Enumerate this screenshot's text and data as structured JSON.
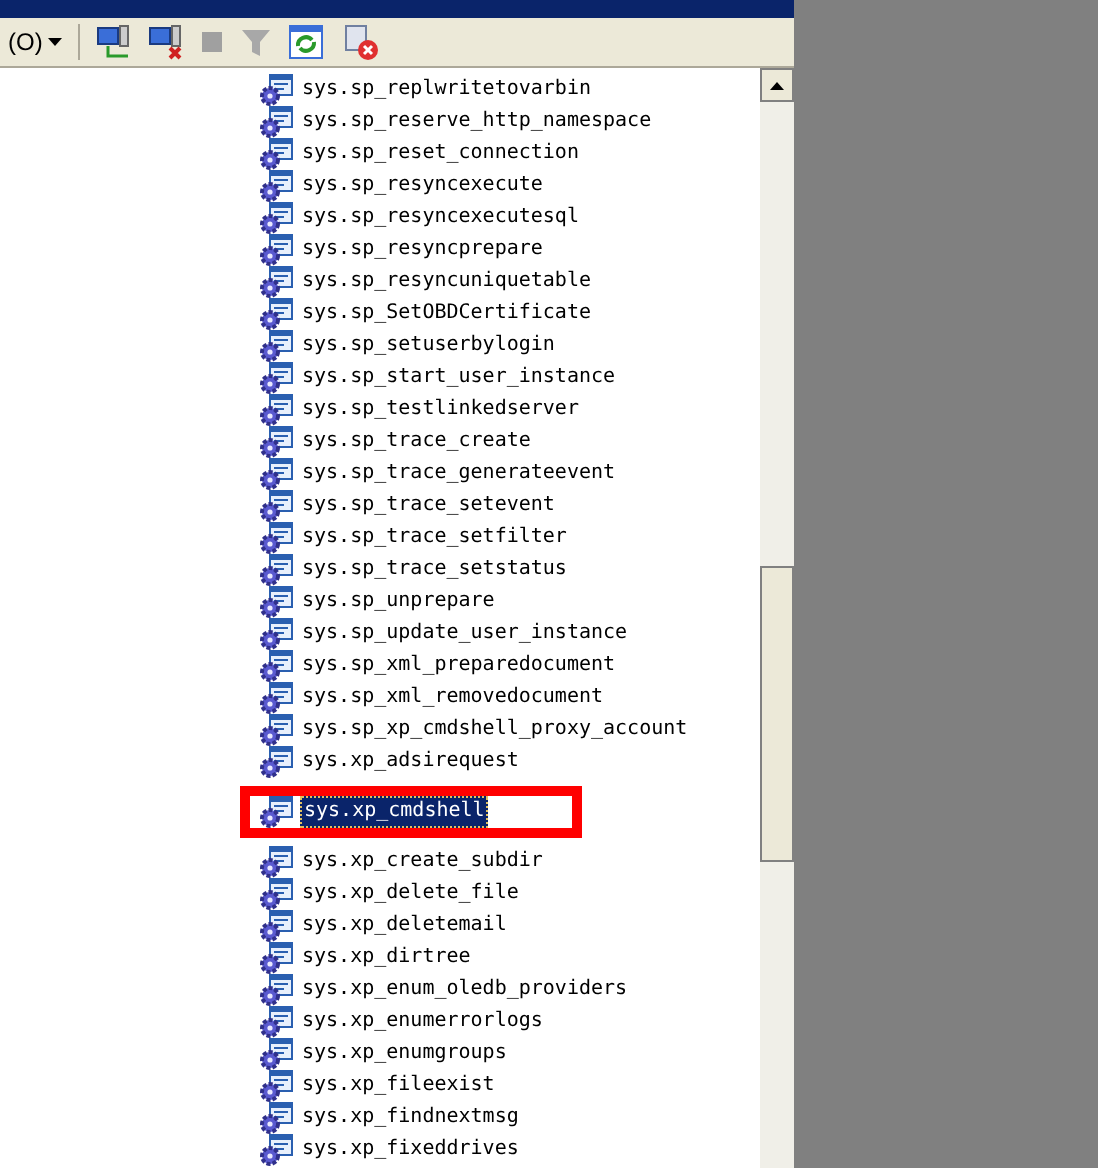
{
  "toolbar": {
    "connect_label": "(O)"
  },
  "tree": {
    "items": [
      {
        "text": "sys.sp_replwritetovarbin",
        "selected": false
      },
      {
        "text": "sys.sp_reserve_http_namespace",
        "selected": false
      },
      {
        "text": "sys.sp_reset_connection",
        "selected": false
      },
      {
        "text": "sys.sp_resyncexecute",
        "selected": false
      },
      {
        "text": "sys.sp_resyncexecutesql",
        "selected": false
      },
      {
        "text": "sys.sp_resyncprepare",
        "selected": false
      },
      {
        "text": "sys.sp_resyncuniquetable",
        "selected": false
      },
      {
        "text": "sys.sp_SetOBDCertificate",
        "selected": false
      },
      {
        "text": "sys.sp_setuserbylogin",
        "selected": false
      },
      {
        "text": "sys.sp_start_user_instance",
        "selected": false
      },
      {
        "text": "sys.sp_testlinkedserver",
        "selected": false
      },
      {
        "text": "sys.sp_trace_create",
        "selected": false
      },
      {
        "text": "sys.sp_trace_generateevent",
        "selected": false
      },
      {
        "text": "sys.sp_trace_setevent",
        "selected": false
      },
      {
        "text": "sys.sp_trace_setfilter",
        "selected": false
      },
      {
        "text": "sys.sp_trace_setstatus",
        "selected": false
      },
      {
        "text": "sys.sp_unprepare",
        "selected": false
      },
      {
        "text": "sys.sp_update_user_instance",
        "selected": false
      },
      {
        "text": "sys.sp_xml_preparedocument",
        "selected": false
      },
      {
        "text": "sys.sp_xml_removedocument",
        "selected": false
      },
      {
        "text": "sys.sp_xp_cmdshell_proxy_account",
        "selected": false
      },
      {
        "text": "sys.xp_adsirequest",
        "selected": false
      },
      {
        "text": "sys.xp_cmdshell",
        "selected": true
      },
      {
        "text": "sys.xp_create_subdir",
        "selected": false
      },
      {
        "text": "sys.xp_delete_file",
        "selected": false
      },
      {
        "text": "sys.xp_deletemail",
        "selected": false
      },
      {
        "text": "sys.xp_dirtree",
        "selected": false
      },
      {
        "text": "sys.xp_enum_oledb_providers",
        "selected": false
      },
      {
        "text": "sys.xp_enumerrorlogs",
        "selected": false
      },
      {
        "text": "sys.xp_enumgroups",
        "selected": false
      },
      {
        "text": "sys.xp_fileexist",
        "selected": false
      },
      {
        "text": "sys.xp_findnextmsg",
        "selected": false
      },
      {
        "text": "sys.xp_fixeddrives",
        "selected": false
      }
    ]
  }
}
